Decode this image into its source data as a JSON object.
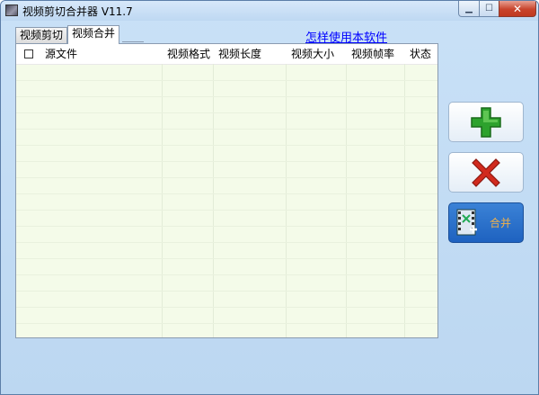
{
  "window": {
    "title": "视频剪切合并器 V11.7"
  },
  "tabs": [
    {
      "label": "视频剪切",
      "active": false
    },
    {
      "label": "视频合并",
      "active": true
    }
  ],
  "help_link": "怎样使用本软件",
  "table": {
    "columns": [
      "源文件",
      "视频格式",
      "视频长度",
      "视频大小",
      "视频帧率",
      "状态"
    ],
    "rows": []
  },
  "buttons": {
    "add_icon": "plus-icon",
    "remove_icon": "x-icon",
    "merge_label": "合并"
  },
  "colors": {
    "list_background": "#f4fbe9",
    "merge_button": "#1e62c0",
    "add_green": "#2da22d",
    "remove_red": "#d12a1e",
    "link": "#0000ff"
  }
}
